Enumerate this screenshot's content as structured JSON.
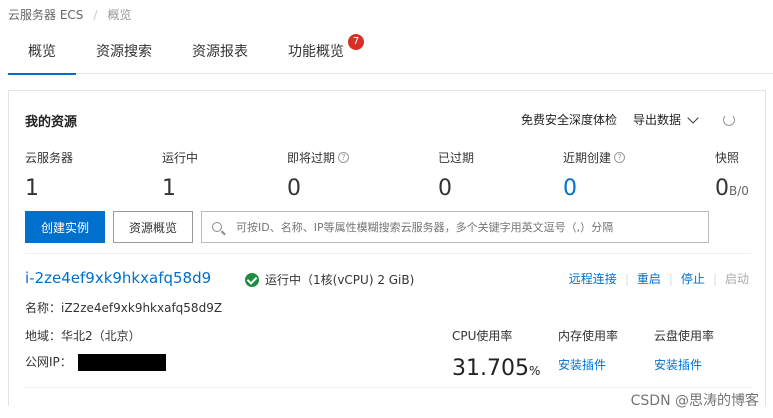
{
  "breadcrumb": {
    "root": "云服务器 ECS",
    "current": "概览"
  },
  "tabs": [
    {
      "label": "概览",
      "active": true
    },
    {
      "label": "资源搜索"
    },
    {
      "label": "资源报表"
    },
    {
      "label": "功能概览",
      "badge": "7"
    }
  ],
  "resources": {
    "title": "我的资源",
    "actions": {
      "security_check": "免费安全深度体检",
      "export": "导出数据"
    },
    "stats": [
      {
        "label": "云服务器",
        "value": "1"
      },
      {
        "label": "运行中",
        "value": "1"
      },
      {
        "label": "即将过期",
        "value": "0",
        "help": "?"
      },
      {
        "label": "已过期",
        "value": "0"
      },
      {
        "label": "近期创建",
        "value": "0",
        "help": "?",
        "accent": "#0070cc"
      },
      {
        "label": "快照",
        "value": "0",
        "unit": "B/0"
      }
    ],
    "buttons": {
      "create": "创建实例",
      "overview": "资源概览"
    },
    "search": {
      "placeholder": "可按ID、名称、IP等属性模糊搜索云服务器，多个关键字用英文逗号（,）分隔"
    }
  },
  "instance": {
    "id": "i-2ze4ef9xk9hkxafq58d9",
    "status": "运行中（1核(vCPU) 2 GiB)",
    "ops": [
      "远程连接",
      "重启",
      "停止",
      "启动"
    ],
    "name_label": "名称：",
    "name": "iZ2ze4ef9xk9hkxafq58d9Z",
    "region_label": "地域：",
    "region": "华北2（北京）",
    "public_ip_label": "公网IP：",
    "cpu": {
      "label": "CPU使用率",
      "value": "31.705",
      "unit": "%"
    },
    "memory": {
      "label": "内存使用率",
      "link": "安装插件"
    },
    "disk": {
      "label": "云盘使用率",
      "link": "安装插件"
    }
  },
  "watermark": "CSDN @思涛的博客",
  "colors": {
    "accent": "#0070cc",
    "badge": "#d93026",
    "running": "#1e8e3e"
  }
}
